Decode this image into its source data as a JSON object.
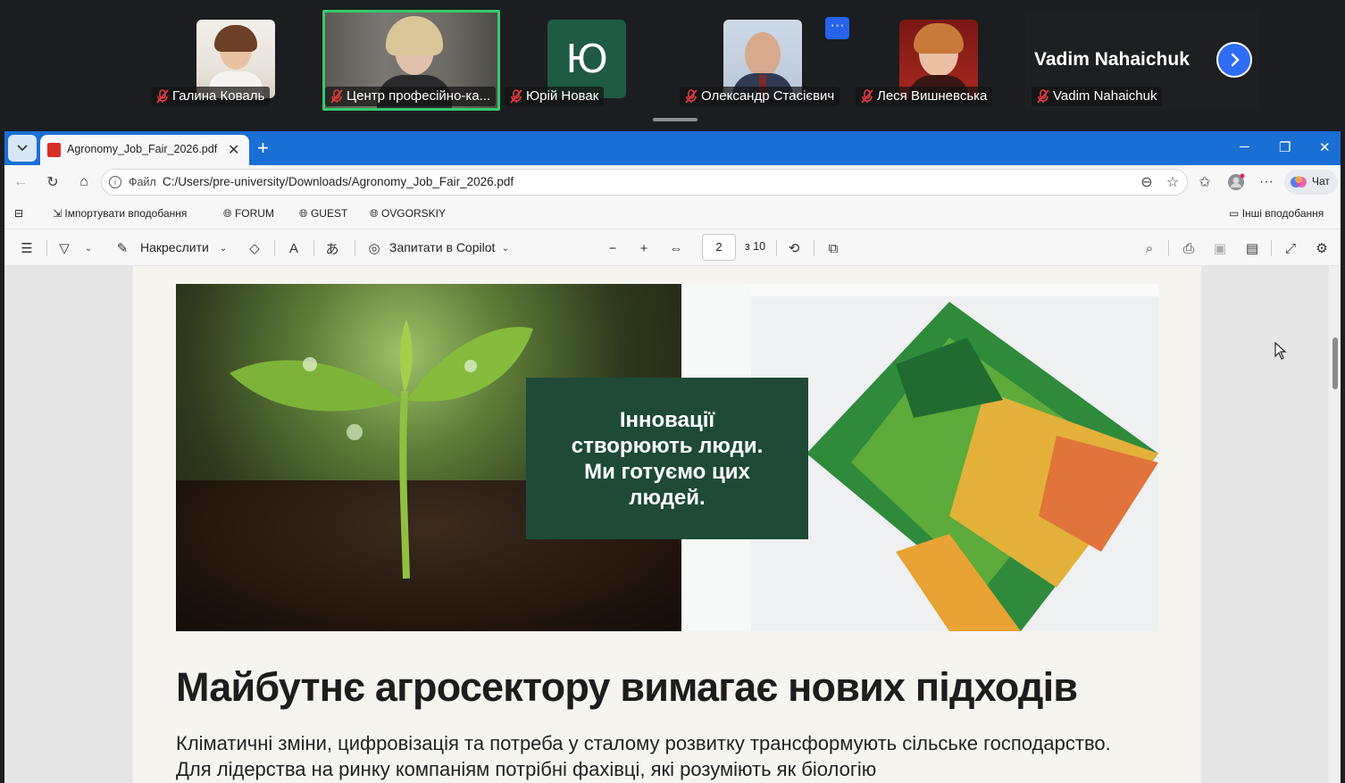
{
  "participants": [
    {
      "name": "Галина  Коваль"
    },
    {
      "name": "Центр професійно-ка..."
    },
    {
      "name": "Юрій Новак",
      "initial": "Ю"
    },
    {
      "name": "Олександр Стасієвич"
    },
    {
      "name": "Леся Вишневська"
    },
    {
      "name": "Vadim Nahaichuk",
      "display": "Vadim Nahaichuk"
    }
  ],
  "strip": {
    "more_label": "···"
  },
  "browser": {
    "tab_title": "Agronomy_Job_Fair_2026.pdf",
    "url_scheme_label": "Файл",
    "url": "C:/Users/pre-university/Downloads/Agronomy_Job_Fair_2026.pdf",
    "chat_label": "Чат",
    "bookmarks": [
      "Імпортувати вподобання",
      "FORUM",
      "GUEST",
      "OVGORSKIY"
    ],
    "other_bookmarks": "Інші вподобання"
  },
  "pdf_toolbar": {
    "draw_label": "Накреслити",
    "copilot_label": "Запитати в Copilot",
    "page_current": "2",
    "page_total": "з 10"
  },
  "document": {
    "hero_card": "Інновації\nстворюють люди.\nМи готуємо цих\nлюдей.",
    "headline": "Майбутнє агросектору вимагає нових підходів",
    "paragraph": "Кліматичні зміни, цифровізація та потреба у сталому розвитку трансформують сільське господарство. Для лідерства на ринку компаніям потрібні фахівці, які розуміють як біологію"
  },
  "colors": {
    "titlebar": "#1a6fd4",
    "active_speaker": "#37c96b",
    "card": "#1e4a36"
  }
}
